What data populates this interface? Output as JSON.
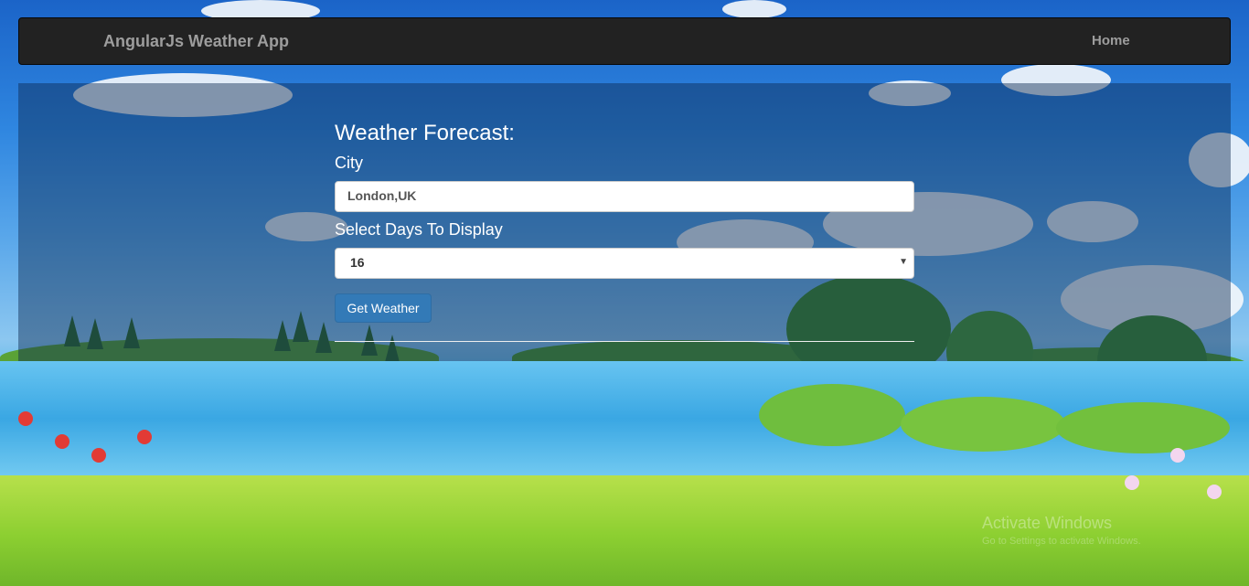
{
  "navbar": {
    "brand": "AngularJs Weather App",
    "home_link": "Home"
  },
  "form": {
    "heading": "Weather Forecast:",
    "city_label": "City",
    "city_value": "London,UK",
    "days_label": "Select Days To Display",
    "days_selected": "16",
    "submit_label": "Get Weather"
  },
  "icons": {
    "select_caret": "chevron-down-icon"
  },
  "watermark": {
    "line1": "Activate Windows",
    "line2": "Go to Settings to activate Windows."
  },
  "colors": {
    "navbar_bg": "#222222",
    "brand_text": "#9d9d9d",
    "button_bg": "#337ab7",
    "panel_overlay": "rgba(10,40,80,0.45)"
  }
}
